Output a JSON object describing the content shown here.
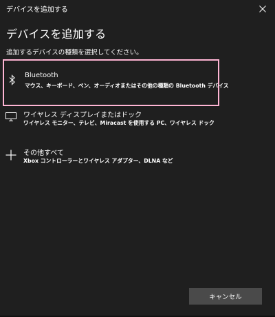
{
  "window": {
    "title": "デバイスを追加する"
  },
  "heading": "デバイスを追加する",
  "instruction": "追加するデバイスの種類を選択してください。",
  "options": [
    {
      "title": "Bluetooth",
      "description": "マウス、キーボード、ペン、オーディオまたはその他の種類の Bluetooth デバイス",
      "icon": "bluetooth-icon",
      "selected": true
    },
    {
      "title": "ワイヤレス ディスプレイまたはドック",
      "description": "ワイヤレス モニター、テレビ、Miracast を使用する PC、ワイヤレス ドック",
      "icon": "monitor-icon",
      "selected": false
    },
    {
      "title": "その他すべて",
      "description": "Xbox コントローラーとワイヤレス アダプター、DLNA など",
      "icon": "plus-icon",
      "selected": false
    }
  ],
  "buttons": {
    "cancel_label": "キャンセル"
  },
  "colors": {
    "background": "#1f1f1f",
    "selection_border": "#ffb5d4",
    "button_bg": "#4a4a4a",
    "text": "#ffffff"
  }
}
